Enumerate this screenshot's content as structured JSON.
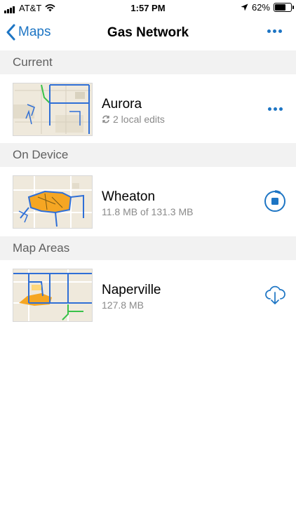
{
  "status_bar": {
    "carrier": "AT&T",
    "time": "1:57 PM",
    "battery": "62%",
    "battery_level": 0.62
  },
  "nav": {
    "back_label": "Maps",
    "title": "Gas Network",
    "more_icon": "ellipsis-icon"
  },
  "sections": {
    "current": {
      "header": "Current",
      "item": {
        "name": "Aurora",
        "subtitle": "2 local edits",
        "action_icon": "ellipsis-icon"
      }
    },
    "on_device": {
      "header": "On Device",
      "item": {
        "name": "Wheaton",
        "subtitle": "11.8 MB of 131.3 MB",
        "download_progress": 0.09,
        "action_icon": "stop-download-icon"
      }
    },
    "map_areas": {
      "header": "Map Areas",
      "item": {
        "name": "Naperville",
        "subtitle": "127.8 MB",
        "action_icon": "cloud-download-icon"
      }
    }
  },
  "colors": {
    "accent": "#1d75c4",
    "section_bg": "#f2f2f2",
    "map_blue": "#2f6fd6",
    "map_orange": "#f5a623",
    "map_green": "#39c24a"
  }
}
